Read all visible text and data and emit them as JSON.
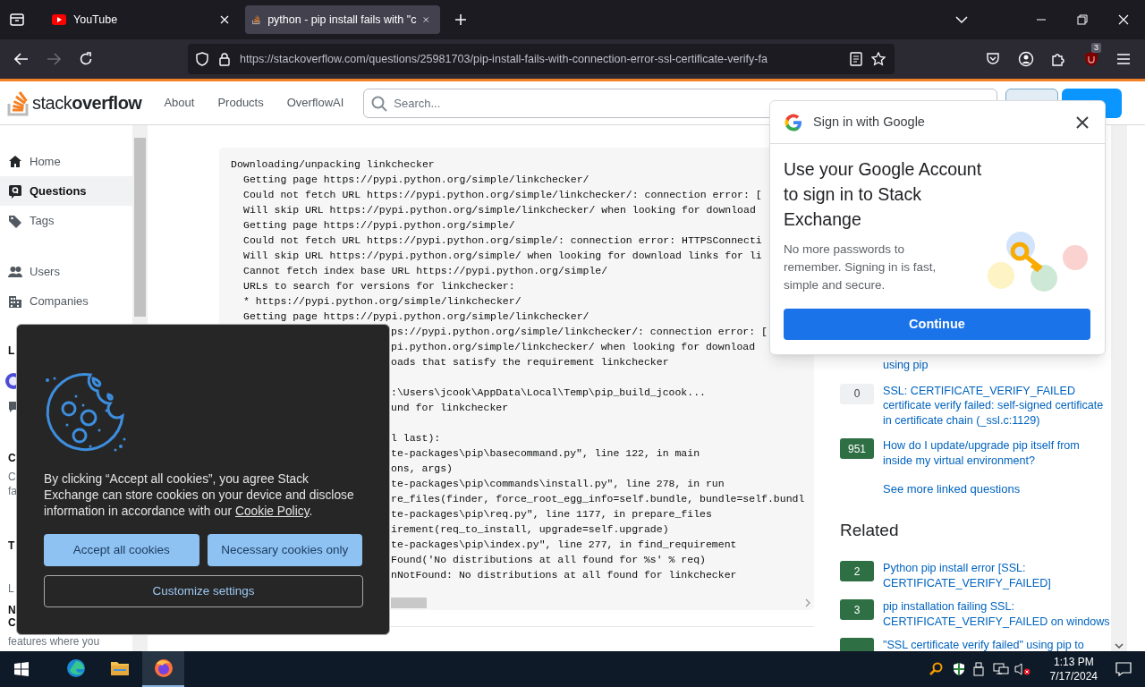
{
  "browser": {
    "tabs": [
      {
        "title": "YouTube",
        "selected": false,
        "kind": "youtube"
      },
      {
        "title": "python - pip install fails with \"c",
        "selected": true,
        "kind": "stack"
      }
    ],
    "url": "https://stackoverflow.com/questions/25981703/pip-install-fails-with-connection-error-ssl-certificate-verify-fa",
    "extension_badge": "3"
  },
  "header": {
    "logo": "stack**overflow**",
    "nav": [
      "About",
      "Products",
      "OverflowAI"
    ],
    "search": {
      "placeholder": "Search..."
    }
  },
  "sidebar": {
    "primary": [
      {
        "label": "Home",
        "selected": false,
        "kind": "home"
      },
      {
        "label": "Questions",
        "selected": true,
        "kind": "questions"
      },
      {
        "label": "Tags",
        "selected": false,
        "kind": "tag"
      }
    ],
    "secondary": [
      {
        "label": "Users",
        "selected": false,
        "kind": "users"
      },
      {
        "label": "Companies",
        "selected": false,
        "kind": "building"
      }
    ],
    "fragments": [
      {
        "text": "L",
        "kind": "heading"
      },
      {
        "kind": "circle"
      },
      {
        "kind": "chat"
      },
      {
        "text": "C",
        "kind": "heading"
      },
      {
        "text": "C",
        "kind": "muted"
      },
      {
        "text": "fa",
        "kind": "muted"
      },
      {
        "text": "T",
        "kind": "heading"
      },
      {
        "text": "L",
        "kind": "muted"
      },
      {
        "text": "N",
        "kind": "heading"
      },
      {
        "text": "C",
        "kind": "heading"
      },
      {
        "text": "features where you",
        "kind": "muted"
      }
    ]
  },
  "code": [
    {
      "kind": "top",
      "text": "Downloading/unpacking linkchecker"
    },
    {
      "kind": "indented",
      "text": "Getting page https://pypi.python.org/simple/linkchecker/"
    },
    {
      "kind": "indented",
      "text": "Could not fetch URL https://pypi.python.org/simple/linkchecker/: connection error: ["
    },
    {
      "kind": "indented",
      "text": "Will skip URL https://pypi.python.org/simple/linkchecker/ when looking for download"
    },
    {
      "kind": "indented",
      "text": "Getting page https://pypi.python.org/simple/"
    },
    {
      "kind": "indented",
      "text": "Could not fetch URL https://pypi.python.org/simple/: connection error: HTTPSConnecti"
    },
    {
      "kind": "indented",
      "text": "Will skip URL https://pypi.python.org/simple/ when looking for download links for li"
    },
    {
      "kind": "indented",
      "text": "Cannot fetch index base URL https://pypi.python.org/simple/"
    },
    {
      "kind": "indented",
      "text": "URLs to search for versions for linkchecker:"
    },
    {
      "kind": "indented",
      "text": "* https://pypi.python.org/simple/linkchecker/"
    },
    {
      "kind": "indented",
      "text": "Getting page https://pypi.python.org/simple/linkchecker/"
    },
    {
      "kind": "behind",
      "text": "ps://pypi.python.org/simple/linkchecker/: connection error: ["
    },
    {
      "kind": "behind",
      "text": "pi.python.org/simple/linkchecker/ when looking for download"
    },
    {
      "kind": "behind",
      "text": "oads that satisfy the requirement linkchecker"
    },
    {
      "kind": "blank"
    },
    {
      "kind": "behind",
      "text": ":\\Users\\jcook\\AppData\\Local\\Temp\\pip_build_jcook..."
    },
    {
      "kind": "behind",
      "text": "und for linkchecker"
    },
    {
      "kind": "blank"
    },
    {
      "kind": "behind",
      "text": "l last):"
    },
    {
      "kind": "behind",
      "text": "te-packages\\pip\\basecommand.py\", line 122, in main"
    },
    {
      "kind": "behind",
      "text": "ons, args)"
    },
    {
      "kind": "behind",
      "text": "te-packages\\pip\\commands\\install.py\", line 278, in run"
    },
    {
      "kind": "behind",
      "text": "re_files(finder, force_root_egg_info=self.bundle, bundle=self.bundl"
    },
    {
      "kind": "behind",
      "text": "te-packages\\pip\\req.py\", line 1177, in prepare_files"
    },
    {
      "kind": "behind",
      "text": "irement(req_to_install, upgrade=self.upgrade)"
    },
    {
      "kind": "behind",
      "text": "te-packages\\pip\\index.py\", line 277, in find_requirement"
    },
    {
      "kind": "behind",
      "text": "Found('No distributions at all found for %s' % req)"
    },
    {
      "kind": "behind",
      "text": "nNotFound: No distributions at all found for linkchecker"
    }
  ],
  "linked": {
    "items": [
      {
        "title": "using pip"
      },
      {
        "votes": "0",
        "title": "SSL: CERTIFICATE_VERIFY_FAILED certificate verify failed: self-signed certificate in certificate chain (_ssl.c:1129)",
        "answered": false
      },
      {
        "votes": "951",
        "title": "How do I update/upgrade pip itself from inside my virtual environment?",
        "answered": true
      }
    ],
    "more": "See more linked questions"
  },
  "related": {
    "title": "Related",
    "items": [
      {
        "votes": "2",
        "title": "Python pip install error [SSL: CERTIFICATE_VERIFY_FAILED]",
        "answered": true
      },
      {
        "votes": "3",
        "title": "pip installation failing SSL: CERTIFICATE_VERIFY_FAILED on windows",
        "answered": true
      },
      {
        "title": "\"SSL certificate verify failed\" using pip to",
        "answered": true
      }
    ]
  },
  "cookie_dialog": {
    "text": "By clicking “Accept all cookies”, you agree Stack Exchange can store cookies on your device and disclose information in accordance with our",
    "link": "Cookie Policy",
    "after": ".",
    "buttons": [
      {
        "label": "Accept all cookies",
        "kind": "primary"
      },
      {
        "label": "Necessary cookies only",
        "kind": "primary"
      },
      {
        "label": "Customize settings",
        "kind": "outline"
      }
    ]
  },
  "google_popup": {
    "title": "Sign in with Google",
    "heading": "Use your Google Account to sign in to Stack Exchange",
    "body": "No more passwords to remember. Signing in is fast, simple and secure.",
    "button": "Continue"
  },
  "taskbar": {
    "apps": [
      {
        "kind": "edge",
        "selected": false
      },
      {
        "kind": "folder",
        "selected": false
      },
      {
        "kind": "firefox",
        "selected": true
      }
    ],
    "time": "1:13 PM",
    "date": "7/17/2024"
  }
}
